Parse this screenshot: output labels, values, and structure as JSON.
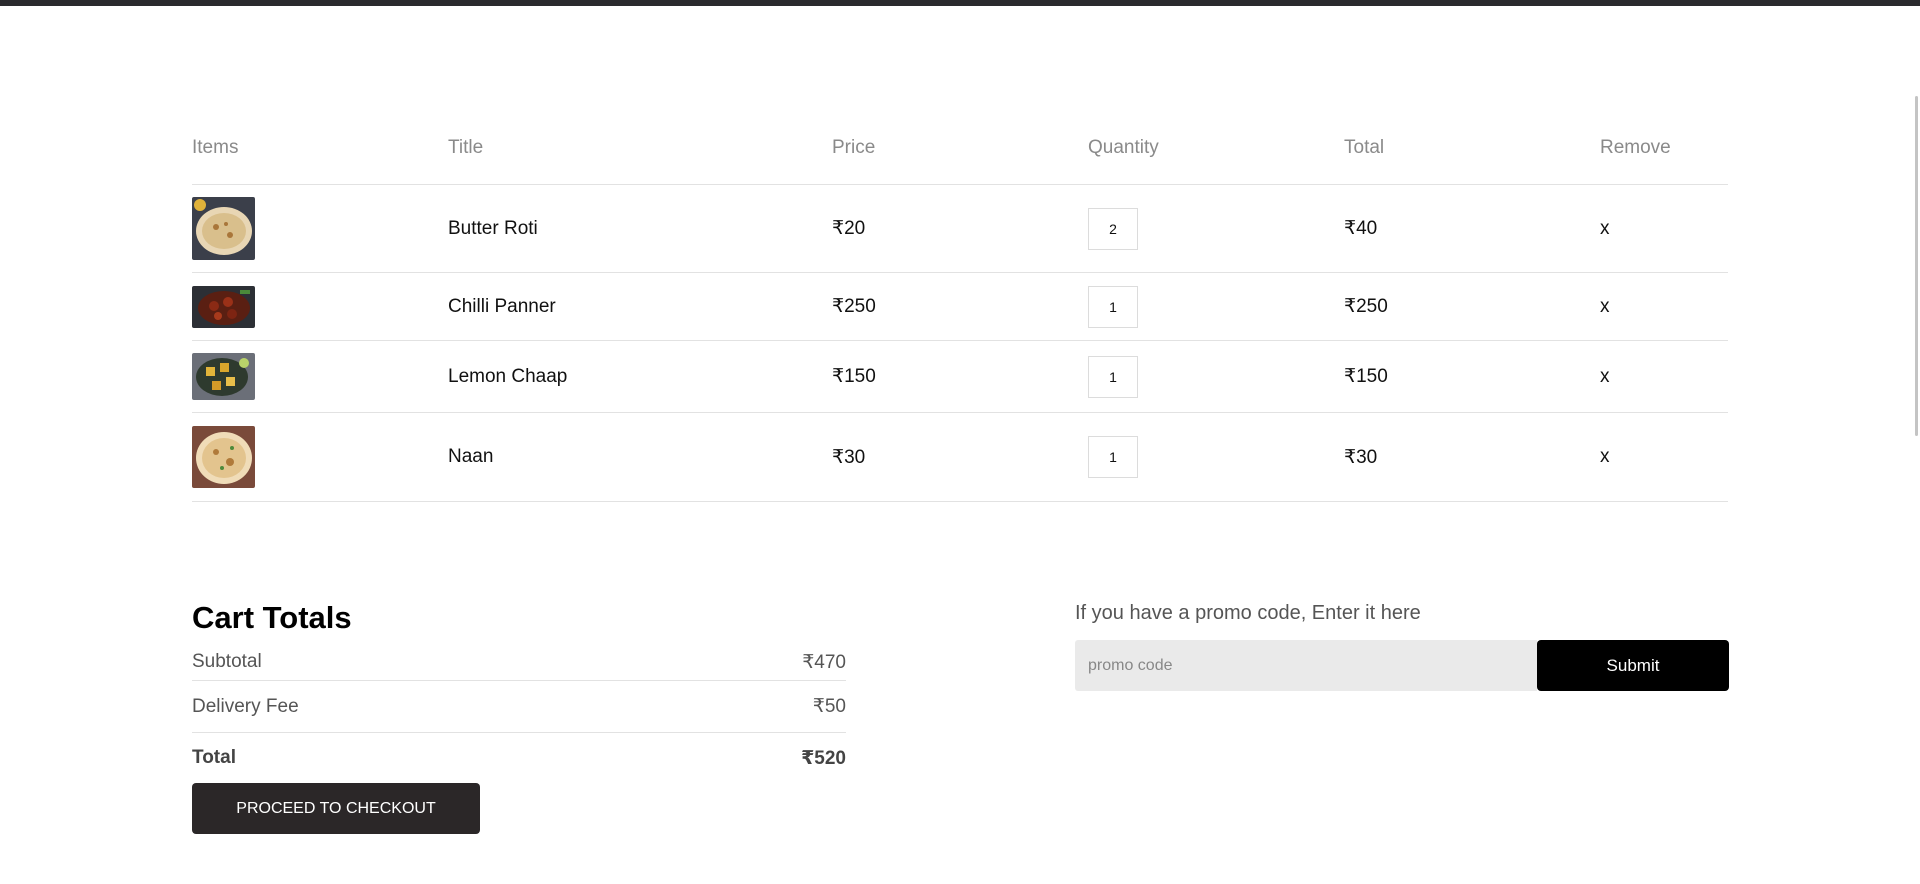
{
  "cart": {
    "headers": [
      "Items",
      "Title",
      "Price",
      "Quantity",
      "Total",
      "Remove"
    ],
    "items": [
      {
        "title": "Butter Roti",
        "price": "₹20",
        "quantity": "2",
        "total": "₹40",
        "remove": "x",
        "image": "butter-roti-image"
      },
      {
        "title": "Chilli Panner",
        "price": "₹250",
        "quantity": "1",
        "total": "₹250",
        "remove": "x",
        "image": "chilli-panner-image"
      },
      {
        "title": "Lemon Chaap",
        "price": "₹150",
        "quantity": "1",
        "total": "₹150",
        "remove": "x",
        "image": "lemon-chaap-image"
      },
      {
        "title": "Naan",
        "price": "₹30",
        "quantity": "1",
        "total": "₹30",
        "remove": "x",
        "image": "naan-image"
      }
    ]
  },
  "totals": {
    "title": "Cart Totals",
    "subtotal_label": "Subtotal",
    "subtotal_value": "₹470",
    "delivery_label": "Delivery Fee",
    "delivery_value": "₹50",
    "total_label": "Total",
    "total_value": "₹520",
    "checkout_label": "PROCEED TO CHECKOUT"
  },
  "promo": {
    "prompt": "If you have a promo code, Enter it here",
    "placeholder": "promo code",
    "submit_label": "Submit"
  },
  "colors": {
    "top_bar": "#2a2a2e",
    "checkout_button": "#2b2728",
    "submit_button": "#000000",
    "promo_input_bg": "#eaeaea"
  }
}
